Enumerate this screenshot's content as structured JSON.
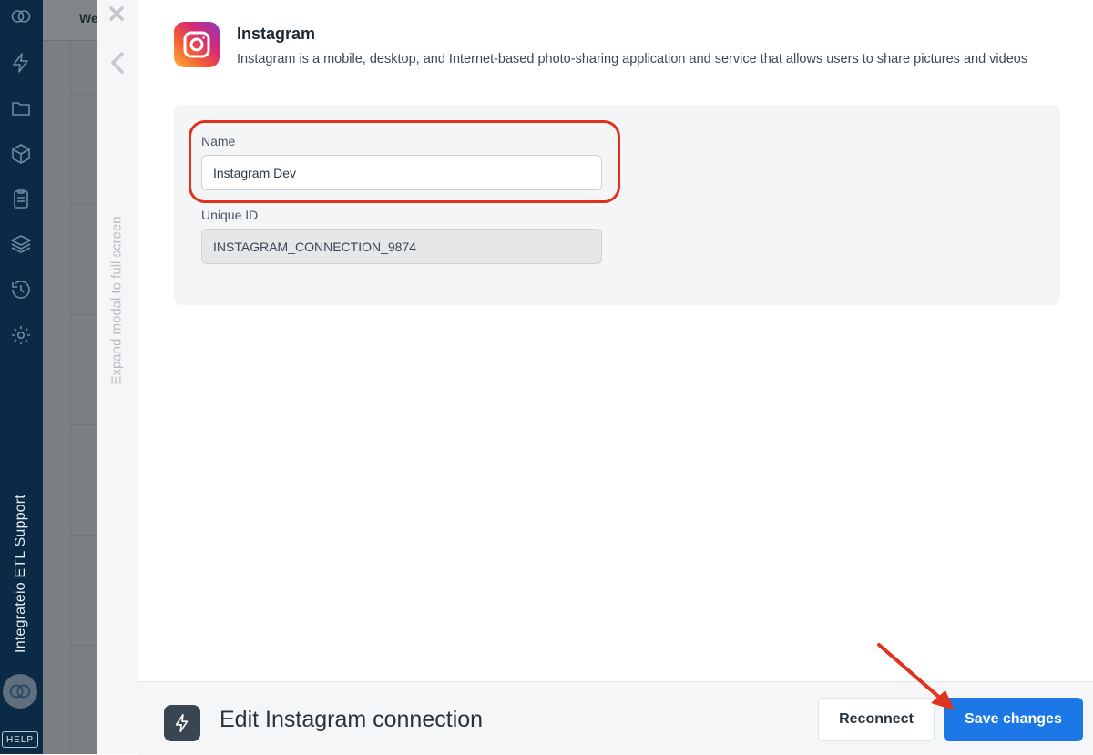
{
  "sidebar": {
    "workspace_label": "Integrateio ETL Support",
    "help_label": "HELP",
    "icons": [
      "logo-icon",
      "lightning-icon",
      "folder-icon",
      "package-icon",
      "clipboard-icon",
      "layers-icon",
      "history-icon",
      "gear-icon"
    ]
  },
  "background": {
    "tab_partial": "We"
  },
  "modal": {
    "expand_label": "Expand modal to full screen",
    "service_name": "Instagram",
    "service_description": "Instagram is a mobile, desktop, and Internet-based photo-sharing application and service that allows users to share pictures and videos",
    "name_label": "Name",
    "name_value": "Instagram Dev",
    "unique_id_label": "Unique ID",
    "unique_id_value": "INSTAGRAM_CONNECTION_9874"
  },
  "footer": {
    "title": "Edit Instagram connection",
    "reconnect_label": "Reconnect",
    "save_label": "Save changes"
  },
  "colors": {
    "nav_bg": "#0b2a45",
    "primary": "#1c78e6",
    "highlight": "#e0321c"
  }
}
